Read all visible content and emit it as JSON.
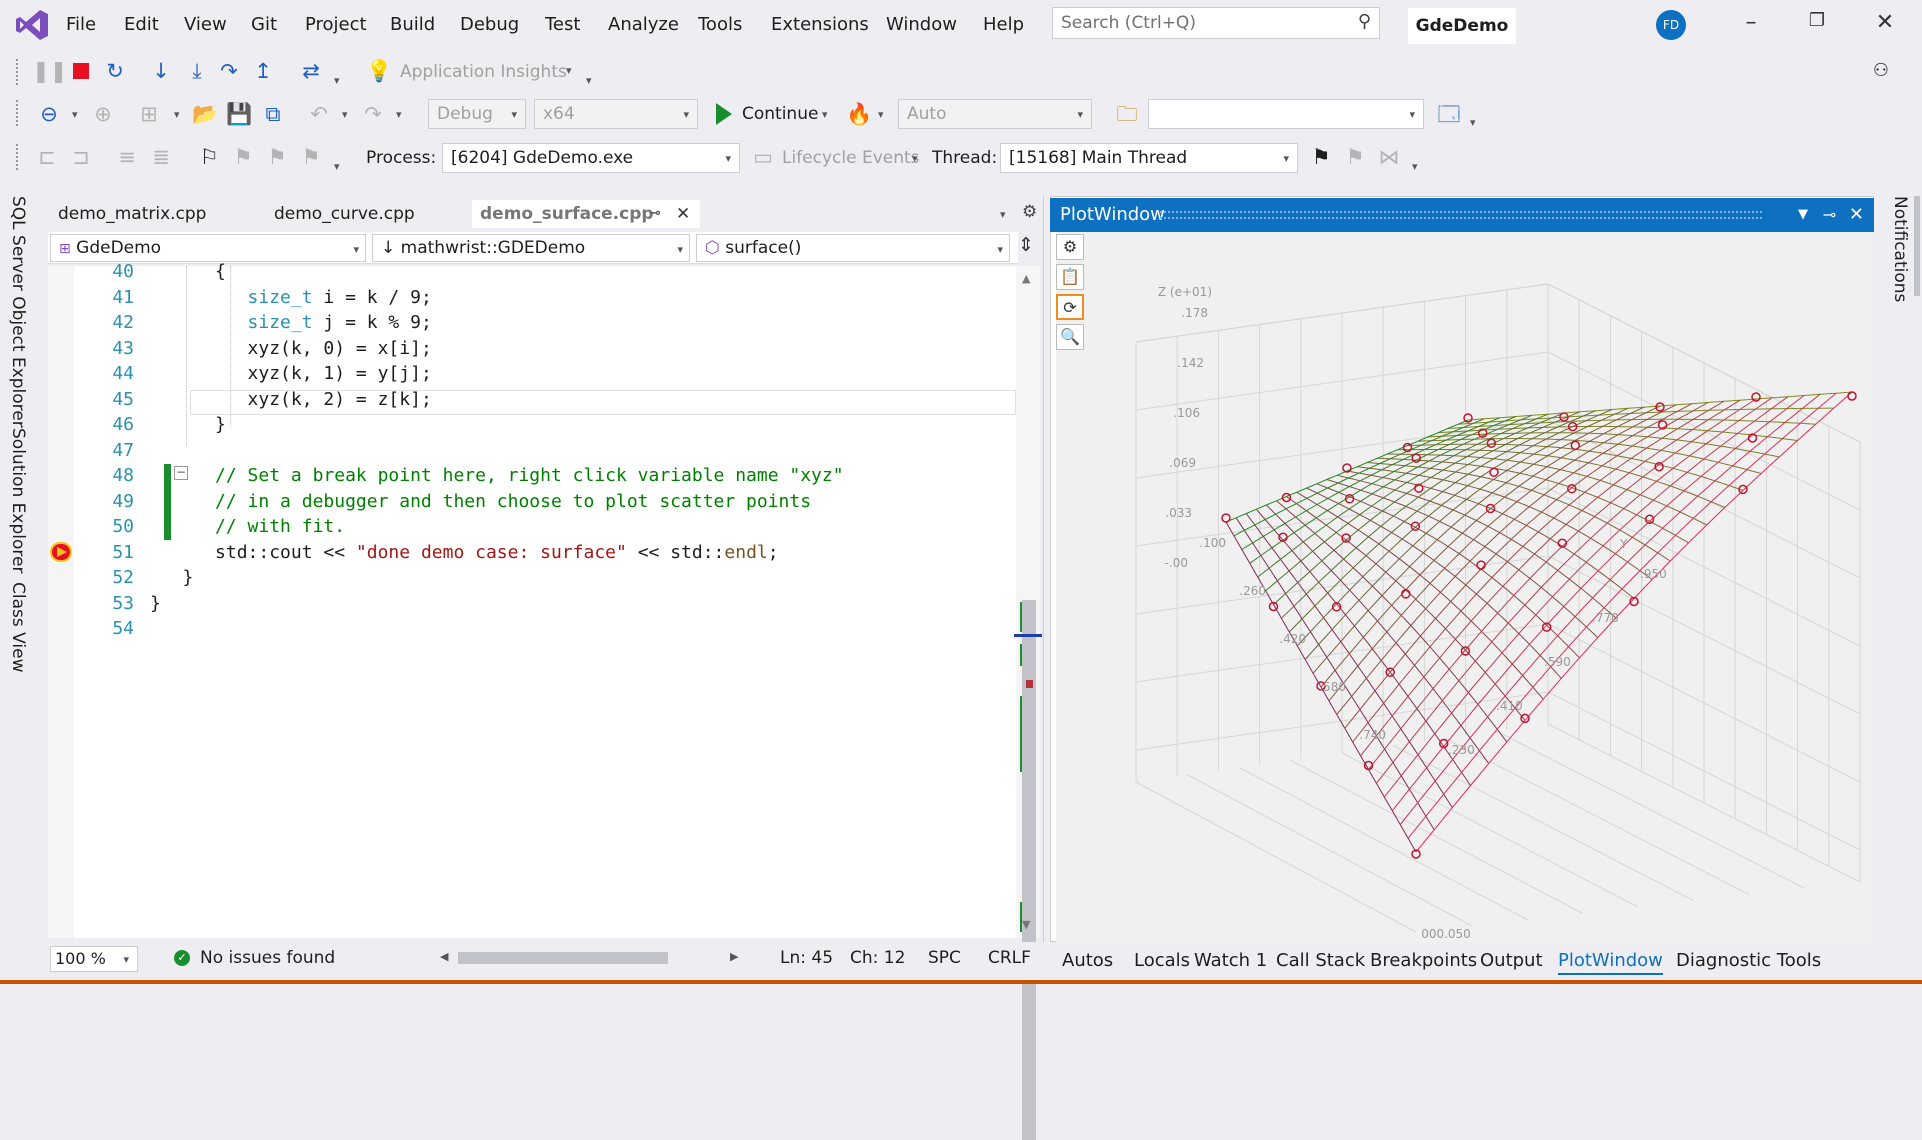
{
  "menubar": {
    "items": [
      "File",
      "Edit",
      "View",
      "Git",
      "Project",
      "Build",
      "Debug",
      "Test",
      "Analyze",
      "Tools",
      "Extensions",
      "Window",
      "Help"
    ],
    "search_placeholder": "Search (Ctrl+Q)",
    "solution_title": "GdeDemo",
    "user_initials": "FD"
  },
  "toolbar1": {
    "app_insights": "Application Insights"
  },
  "toolbar2": {
    "config": "Debug",
    "platform": "x64",
    "continue_label": "Continue",
    "auto": "Auto",
    "empty_combo": ""
  },
  "toolbar3": {
    "process_label": "Process:",
    "process_value": "[6204] GdeDemo.exe",
    "lifecycle": "Lifecycle Events",
    "thread_label": "Thread:",
    "thread_value": "[15168] Main Thread"
  },
  "side_tabs": [
    "SQL Server Object Explorer",
    "Solution Explorer",
    "Class View"
  ],
  "notifications_label": "Notifications",
  "editor": {
    "tabs": [
      "demo_matrix.cpp",
      "demo_curve.cpp",
      "demo_surface.cpp"
    ],
    "nav_project": "GdeDemo",
    "nav_scope": "mathwrist::GDEDemo",
    "nav_member": "surface()",
    "line_numbers": [
      "40",
      "41",
      "42",
      "43",
      "44",
      "45",
      "46",
      "47",
      "48",
      "49",
      "50",
      "51",
      "52",
      "53",
      "54"
    ],
    "lines": [
      {
        "indent": "      ",
        "parts": [
          {
            "t": "{",
            "c": ""
          }
        ]
      },
      {
        "indent": "         ",
        "parts": [
          {
            "t": "size_t",
            "c": "kw"
          },
          {
            "t": " i = k / 9;",
            "c": ""
          }
        ]
      },
      {
        "indent": "         ",
        "parts": [
          {
            "t": "size_t",
            "c": "kw"
          },
          {
            "t": " j = k % 9;",
            "c": ""
          }
        ]
      },
      {
        "indent": "         ",
        "parts": [
          {
            "t": "xyz(k, 0) = x[i];",
            "c": ""
          }
        ]
      },
      {
        "indent": "         ",
        "parts": [
          {
            "t": "xyz(k, 1) = y[j];",
            "c": ""
          }
        ]
      },
      {
        "indent": "         ",
        "parts": [
          {
            "t": "xyz(k, 2) = z[k];",
            "c": ""
          }
        ]
      },
      {
        "indent": "      ",
        "parts": [
          {
            "t": "}",
            "c": ""
          }
        ]
      },
      {
        "indent": "",
        "parts": [
          {
            "t": "",
            "c": ""
          }
        ]
      },
      {
        "indent": "      ",
        "parts": [
          {
            "t": "// Set a break point here, right click variable name \"xyz\"",
            "c": "cm"
          }
        ]
      },
      {
        "indent": "      ",
        "parts": [
          {
            "t": "// in a debugger and then choose to plot scatter points",
            "c": "cm"
          }
        ]
      },
      {
        "indent": "      ",
        "parts": [
          {
            "t": "// with fit.",
            "c": "cm"
          }
        ]
      },
      {
        "indent": "      ",
        "parts": [
          {
            "t": "std::cout << ",
            "c": ""
          },
          {
            "t": "\"done demo case: surface\"",
            "c": "st"
          },
          {
            "t": " << std::",
            "c": ""
          },
          {
            "t": "endl",
            "c": "fn"
          },
          {
            "t": ";",
            "c": ""
          }
        ]
      },
      {
        "indent": "   ",
        "parts": [
          {
            "t": "}",
            "c": ""
          }
        ]
      },
      {
        "indent": "",
        "parts": [
          {
            "t": "}",
            "c": ""
          }
        ]
      },
      {
        "indent": "",
        "parts": [
          {
            "t": "",
            "c": ""
          }
        ]
      }
    ],
    "zoom": "100 %",
    "issues": "No issues found",
    "ln": "Ln: 45",
    "ch": "Ch: 12",
    "spc": "SPC",
    "crlf": "CRLF"
  },
  "plot": {
    "title": "PlotWindow",
    "z_label": "Z (e+01)",
    "y_label": "Y",
    "z_ticks": [
      ".178",
      ".142",
      ".106",
      ".069",
      ".033",
      "-.00"
    ],
    "x_ticks": [
      ".100",
      ".260",
      ".420",
      ".580",
      ".740"
    ],
    "y_ticks": [
      ".950",
      ".770",
      ".590",
      ".410",
      ".230"
    ],
    "bottom_cut": "000.050"
  },
  "bottom_tabs": [
    "Autos",
    "Locals",
    "Watch 1",
    "Call Stack",
    "Breakpoints",
    "Output",
    "PlotWindow",
    "Diagnostic Tools"
  ],
  "colors": {
    "accent": "#0e70c0",
    "comment": "#008000",
    "string": "#a31515",
    "keyword": "#2b91af",
    "breakpoint": "#e81123"
  }
}
